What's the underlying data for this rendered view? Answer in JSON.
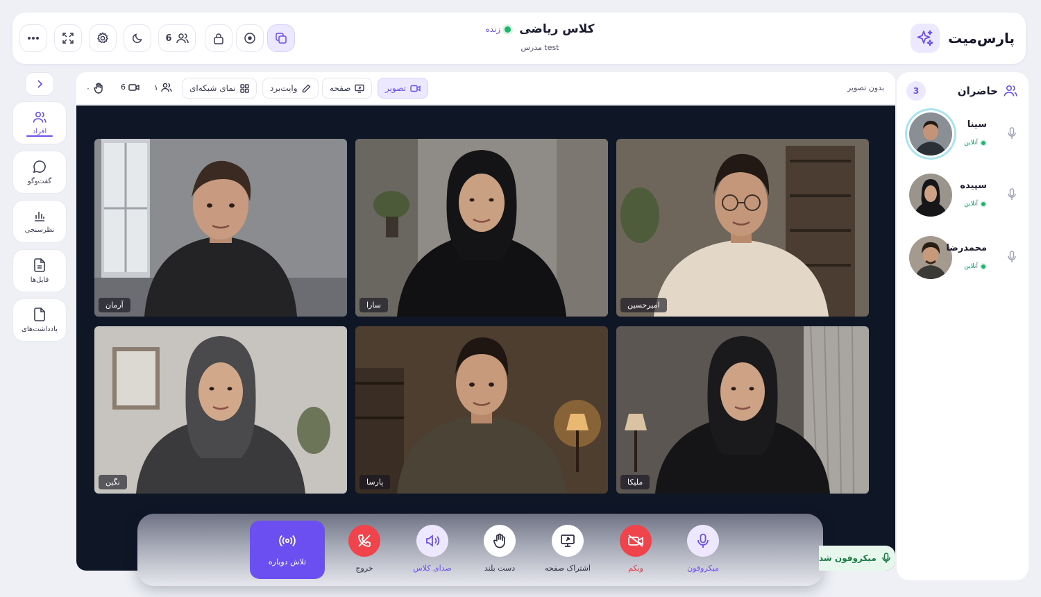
{
  "app": {
    "brand_name": "پارس‌میت",
    "class_title": "کلاس ریاضی",
    "live_label": "زنده",
    "teacher_label": "مدرس test",
    "participants_count": "6"
  },
  "toolbar": {
    "video_tab": "تصویر",
    "screen_tab": "صفحه",
    "whiteboard_tab": "وایت‌برد",
    "grid_tab": "نمای شبکه‌ای",
    "people_count": "۱",
    "camera_count": "6",
    "hand_count": "۰",
    "no_video_label": "بدون تصویر"
  },
  "left_rail": {
    "items": [
      {
        "label": "افراد",
        "icon": "people-icon",
        "active": true
      },
      {
        "label": "گفت‌وگو",
        "icon": "chat-icon",
        "active": false
      },
      {
        "label": "نظرسنجی",
        "icon": "poll-icon",
        "active": false
      },
      {
        "label": "فایل‌ها",
        "icon": "file-icon",
        "active": false
      },
      {
        "label": "یادداشت‌های",
        "icon": "note-icon",
        "active": false
      }
    ]
  },
  "stage": {
    "tiles": [
      {
        "name": "آرمان"
      },
      {
        "name": "سارا"
      },
      {
        "name": "امیرحسین"
      },
      {
        "name": "نگین"
      },
      {
        "name": "پارسا"
      },
      {
        "name": "ملیکا"
      }
    ]
  },
  "controls": {
    "retry": "تلاش دوباره",
    "leave": "خروج",
    "class_audio": "صدای کلاس",
    "raise_hand": "دست بلند",
    "share_screen": "اشتراک صفحه",
    "webcam": "وبکم",
    "microphone": "میکروفون",
    "mic_toast": "میکروفون شد"
  },
  "panel": {
    "title": "حاضران",
    "count": "3",
    "participants": [
      {
        "name": "سینا",
        "status": "آنلاین"
      },
      {
        "name": "سپیده",
        "status": "آنلاین"
      },
      {
        "name": "محمدرضا",
        "status": "آنلاین"
      }
    ]
  },
  "colors": {
    "accent": "#6b4ff0",
    "danger": "#f0444d",
    "online": "#1fb36b",
    "stage_bg": "#0f1626"
  }
}
